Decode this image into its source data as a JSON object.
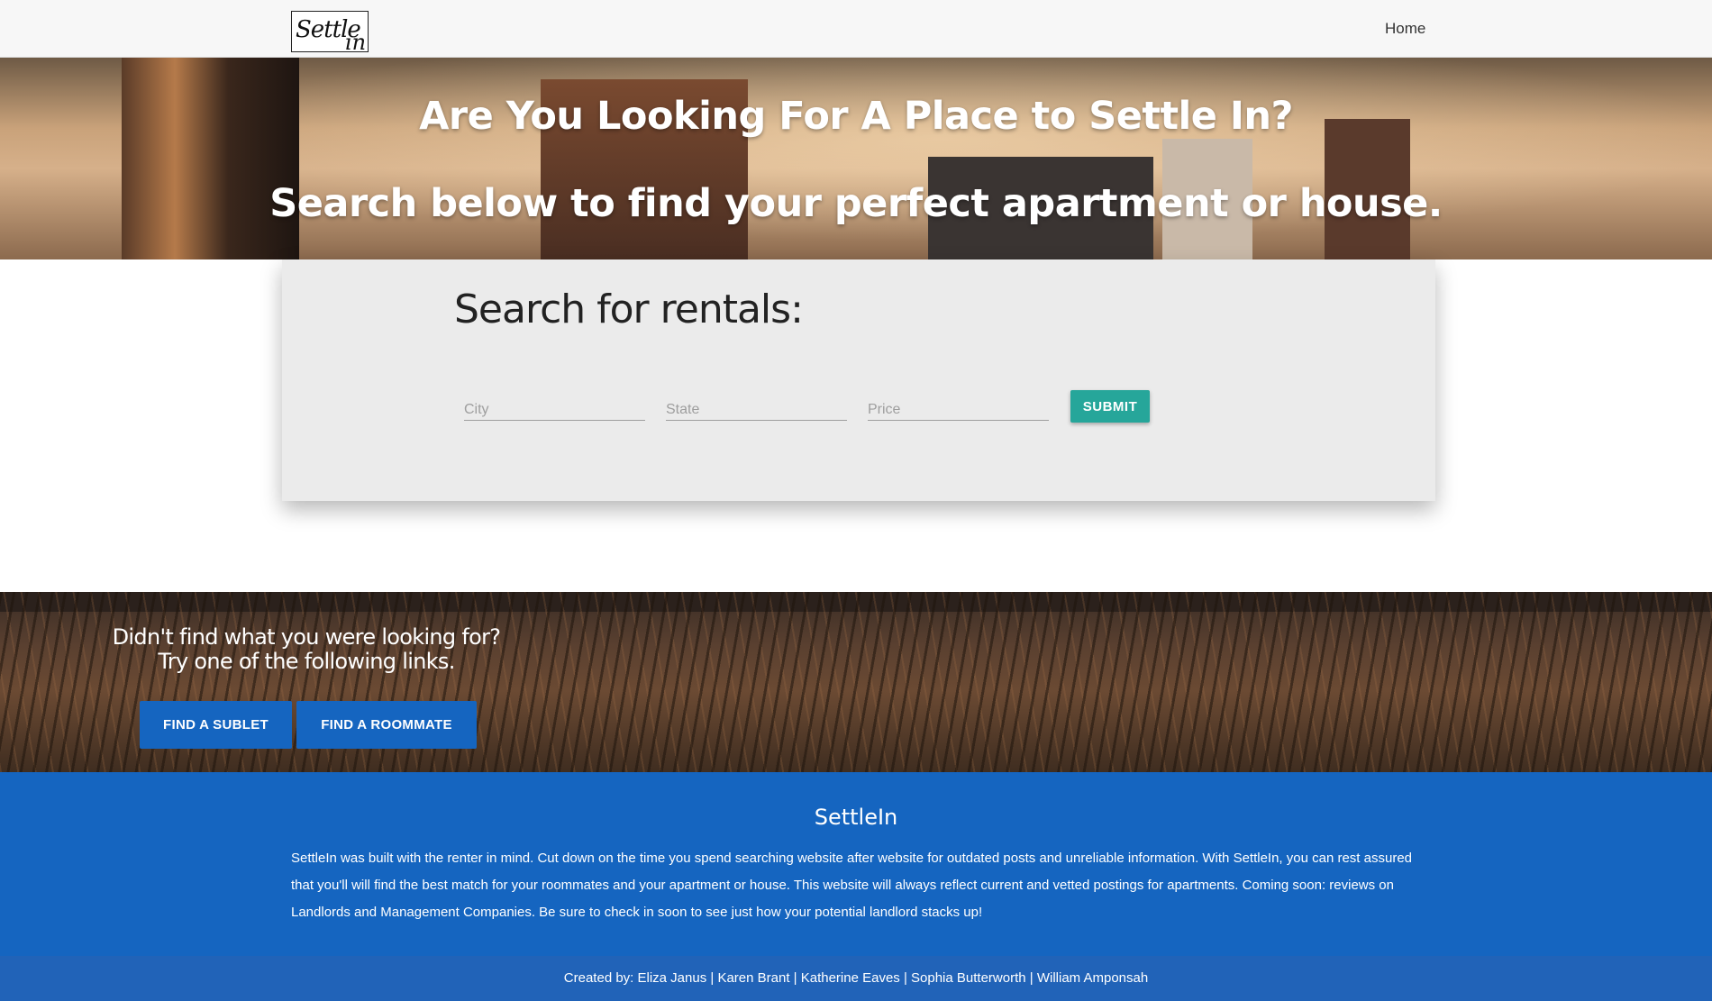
{
  "nav": {
    "logo_main": "Settle",
    "logo_sub": "in",
    "home_label": "Home"
  },
  "hero": {
    "title": "Are You Looking For A Place to Settle In?",
    "subtitle": "Search below to find your perfect apartment or house."
  },
  "search": {
    "heading": "Search for rentals:",
    "city_placeholder": "City",
    "state_placeholder": "State",
    "price_placeholder": "Price",
    "submit_label": "SUBMIT"
  },
  "band": {
    "text": "Didn't find what you were looking for? Try one of the following links.",
    "sublet_label": "FIND A SUBLET",
    "roommate_label": "FIND A ROOMMATE"
  },
  "footer": {
    "title": "SettleIn",
    "body": "SettleIn was built with the renter in mind. Cut down on the time you spend searching website after website for outdated posts and unreliable information. With SettleIn, you can rest assured that you'll will find the best match for your roommates and your apartment or house. This website will always reflect current and vetted postings for apartments. Coming soon: reviews on Landlords and Management Companies. Be sure to check in soon to see just how your potential landlord stacks up!",
    "credits": "Created by: Eliza Janus | Karen Brant | Katherine Eaves | Sophia Butterworth | William Amponsah"
  },
  "colors": {
    "accent_teal": "#26a69a",
    "brand_blue": "#1565c0"
  }
}
